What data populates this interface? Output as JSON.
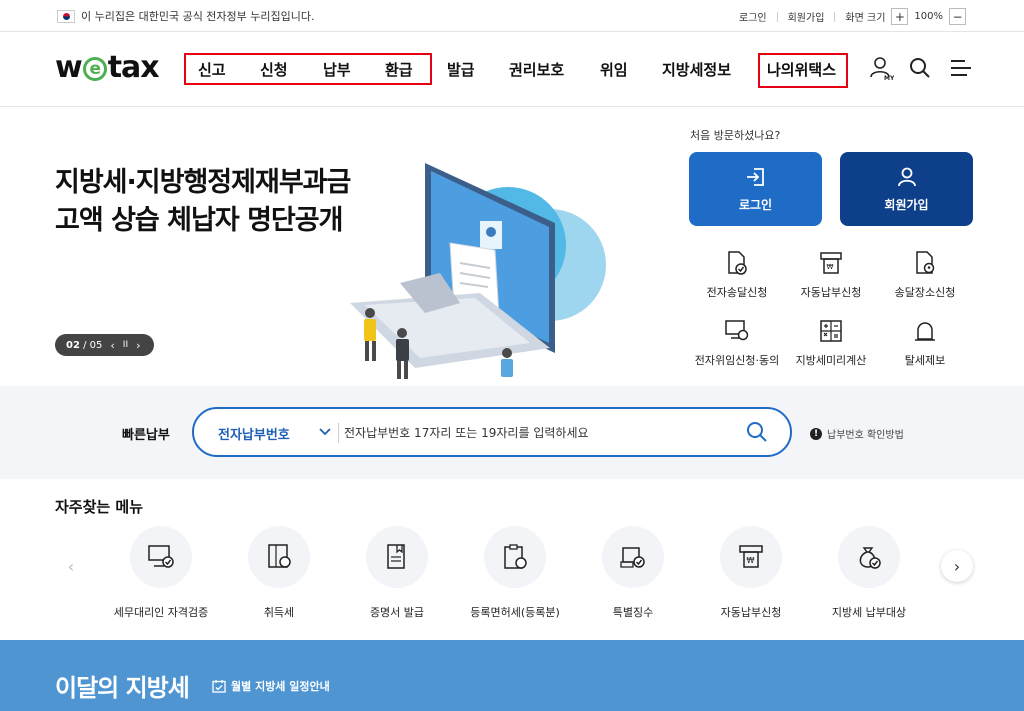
{
  "topbar": {
    "gov_notice": "이 누리집은 대한민국 공식 전자정부 누리집입니다.",
    "login": "로그인",
    "signup": "회원가입",
    "zoom_label": "화면 크기",
    "zoom_plus": "+",
    "zoom_value": "100%",
    "zoom_minus": "−"
  },
  "header": {
    "logo_w": "w",
    "logo_e": "e",
    "logo_rest": "tax",
    "nav": [
      "신고",
      "신청",
      "납부",
      "환급",
      "발급",
      "권리보호",
      "위임",
      "지방세정보",
      "나의위택스"
    ],
    "mypage_badge": "MY"
  },
  "hero": {
    "title_line1": "지방세·지방행정제재부과금",
    "title_line2": "고액 상습 체납자 명단공개",
    "slide_current": "02",
    "slide_total": "/ 05",
    "prev": "‹",
    "pause": "II",
    "next": "›"
  },
  "side": {
    "visit_question": "처음 방문하셨나요?",
    "login_button": "로그인",
    "signup_button": "회원가입",
    "services": [
      "전자송달신청",
      "자동납부신청",
      "송달장소신청",
      "전자위임신청·동의",
      "지방세미리계산",
      "탈세제보"
    ]
  },
  "quick": {
    "label": "빠른납부",
    "select_value": "전자납부번호",
    "placeholder": "전자납부번호 17자리 또는 19자리를 입력하세요",
    "help": "납부번호 확인방법",
    "help_mark": "!"
  },
  "frequent": {
    "title": "자주찾는 메뉴",
    "prev": "‹",
    "next": "›",
    "items": [
      "세무대리인 자격검증",
      "취득세",
      "증명서 발급",
      "등록면허세(등록분)",
      "특별징수",
      "자동납부신청",
      "지방세 납부대상"
    ]
  },
  "monthly": {
    "title": "이달의 지방세",
    "link": "월별 지방세 일정안내"
  },
  "colors": {
    "primary_blue": "#1f6cc7",
    "dark_blue": "#0d3f8a",
    "highlight_red": "#e60012",
    "band_blue": "#4f95d2"
  }
}
